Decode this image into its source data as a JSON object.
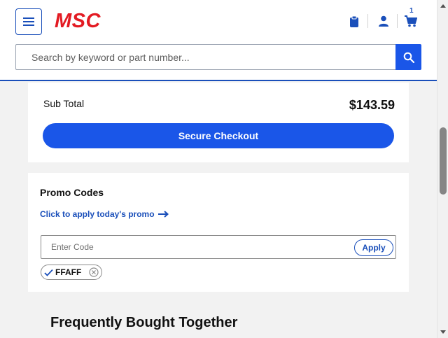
{
  "header": {
    "logo_text": "MSC",
    "cart_count": "1",
    "search": {
      "placeholder": "Search by keyword or part number..."
    },
    "icons": [
      "menu-icon",
      "clipboard-icon",
      "user-icon",
      "cart-icon",
      "search-icon"
    ]
  },
  "summary": {
    "subtotal_label": "Sub Total",
    "subtotal_value": "$143.59",
    "checkout_label": "Secure Checkout"
  },
  "promo": {
    "title": "Promo Codes",
    "link_label": "Click to apply today's promo",
    "code_placeholder": "Enter Code",
    "apply_label": "Apply",
    "applied_code": "FFAFF"
  },
  "recommendations": {
    "title": "Frequently Bought Together"
  },
  "colors": {
    "brand_red": "#e31b23",
    "primary_blue": "#1a56e8",
    "link_blue": "#1a4fba"
  }
}
